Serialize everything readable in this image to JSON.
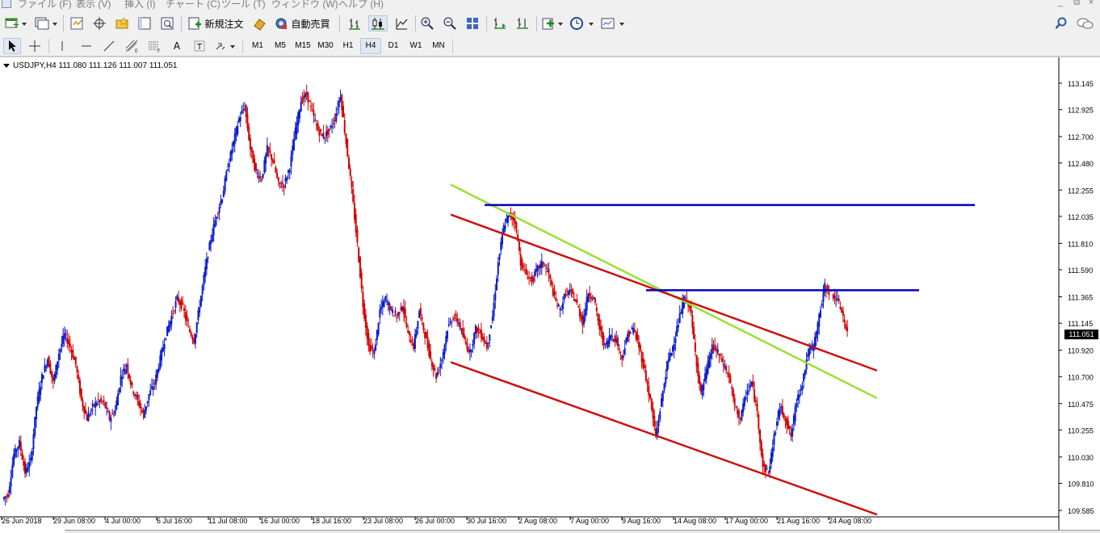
{
  "menu": {
    "items": [
      "ファイル (F)",
      "表示 (V)",
      "挿入 (I)",
      "チャート (C)",
      "ツール (T)",
      "ウィンドウ (W)",
      "ヘルプ (H)"
    ],
    "window_buttons": [
      "_",
      "⧉",
      "×"
    ]
  },
  "toolbar": {
    "new_order_label": "新規注文",
    "auto_trade_label": "自動売買"
  },
  "timeframes": [
    "M1",
    "M5",
    "M15",
    "M30",
    "H1",
    "H4",
    "D1",
    "W1",
    "MN"
  ],
  "active_timeframe": "H4",
  "chart": {
    "symbol_info": "USDJPY,H4  111.080 111.126 111.007 111.051",
    "current_price_label": "111.051"
  },
  "chart_data": {
    "type": "candlestick",
    "symbol": "USDJPY",
    "timeframe": "H4",
    "ohlc_last": {
      "open": 111.08,
      "high": 111.126,
      "low": 111.007,
      "close": 111.051
    },
    "current_price": 111.051,
    "ylim": [
      109.5,
      113.25
    ],
    "y_ticks": [
      113.145,
      112.925,
      112.7,
      112.48,
      112.255,
      112.035,
      111.81,
      111.59,
      111.365,
      111.145,
      110.92,
      110.7,
      110.475,
      110.255,
      110.03,
      109.81,
      109.585
    ],
    "x_ticks": [
      "26 Jun 2018",
      "29 Jun 08:00",
      "4 Jul 00:00",
      "6 Jul 16:00",
      "11 Jul 08:00",
      "16 Jul 00:00",
      "18 Jul 16:00",
      "23 Jul 08:00",
      "26 Jul 00:00",
      "30 Jul 16:00",
      "2 Aug 08:00",
      "7 Aug 00:00",
      "9 Aug 16:00",
      "14 Aug 08:00",
      "17 Aug 00:00",
      "21 Aug 16:00",
      "24 Aug 08:00"
    ],
    "up_color": "#0a1ccc",
    "down_color": "#d20000",
    "price_path": [
      109.68,
      109.72,
      110.05,
      110.15,
      109.9,
      110.0,
      110.45,
      110.7,
      110.85,
      110.65,
      110.9,
      111.05,
      110.95,
      110.8,
      110.5,
      110.35,
      110.45,
      110.5,
      110.48,
      110.35,
      110.42,
      110.7,
      110.8,
      110.6,
      110.5,
      110.38,
      110.55,
      110.65,
      110.85,
      111.05,
      111.2,
      111.35,
      111.28,
      111.1,
      111.0,
      111.3,
      111.6,
      111.85,
      112.05,
      112.2,
      112.45,
      112.65,
      112.85,
      112.95,
      112.6,
      112.4,
      112.35,
      112.6,
      112.5,
      112.3,
      112.3,
      112.45,
      112.75,
      113.0,
      113.05,
      112.9,
      112.75,
      112.7,
      112.75,
      112.85,
      113.05,
      112.65,
      112.25,
      111.8,
      111.3,
      110.95,
      110.9,
      111.25,
      111.35,
      111.25,
      111.2,
      111.3,
      111.05,
      110.95,
      111.25,
      111.05,
      110.85,
      110.7,
      110.85,
      111.1,
      111.2,
      111.15,
      111.0,
      110.9,
      111.1,
      111.05,
      110.95,
      111.2,
      111.65,
      111.95,
      112.05,
      112.0,
      111.65,
      111.55,
      111.5,
      111.6,
      111.65,
      111.55,
      111.35,
      111.25,
      111.4,
      111.4,
      111.3,
      111.15,
      111.4,
      111.35,
      111.1,
      110.95,
      111.05,
      111.0,
      110.85,
      111.05,
      111.1,
      110.95,
      110.75,
      110.5,
      110.2,
      110.5,
      110.8,
      110.95,
      111.15,
      111.35,
      111.3,
      110.9,
      110.55,
      110.75,
      110.95,
      110.9,
      110.8,
      110.7,
      110.45,
      110.35,
      110.55,
      110.65,
      110.4,
      109.95,
      109.9,
      110.2,
      110.45,
      110.35,
      110.2,
      110.5,
      110.65,
      110.9,
      110.95,
      111.2,
      111.45,
      111.4,
      111.35,
      111.25,
      111.05
    ],
    "trendlines": [
      {
        "color": "#98e030",
        "from": [
          "30 Jul 16:00",
          112.3
        ],
        "to": [
          "24 Aug 08:00",
          110.52
        ]
      },
      {
        "color": "#cc1111",
        "from": [
          "30 Jul 16:00",
          112.05
        ],
        "to": [
          "24 Aug 08:00",
          110.75
        ]
      },
      {
        "color": "#cc1111",
        "from": [
          "30 Jul 16:00",
          110.82
        ],
        "to": [
          "24 Aug 08:00",
          109.55
        ]
      }
    ],
    "horizontal_lines": [
      {
        "color": "#0000c8",
        "price": 112.13
      },
      {
        "color": "#0000c8",
        "price": 111.42
      }
    ],
    "grid": false
  }
}
